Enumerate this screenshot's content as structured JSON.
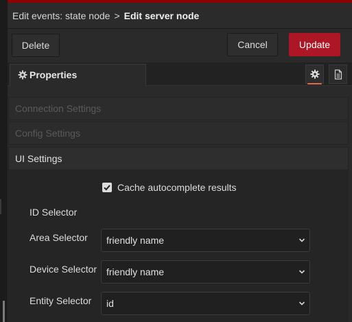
{
  "colors": {
    "accent_top": "#8f0000",
    "update_button": "#ad1625",
    "active_tab_underline": "#e36b4b"
  },
  "header": {
    "breadcrumb_parent": "Edit events: state node",
    "breadcrumb_separator": ">",
    "breadcrumb_current": "Edit server node"
  },
  "toolbar": {
    "delete_label": "Delete",
    "cancel_label": "Cancel",
    "update_label": "Update"
  },
  "tabs": {
    "properties_label": "Properties",
    "properties_icon": "gear-icon",
    "side_icons": [
      "gear-icon",
      "document-icon"
    ]
  },
  "sections": {
    "connection": "Connection Settings",
    "config": "Config Settings",
    "ui": "UI Settings"
  },
  "ui_settings": {
    "cache_checkbox_label": "Cache autocomplete results",
    "cache_checked": true,
    "id_selector_label": "ID Selector",
    "area_selector_label": "Area Selector",
    "area_selector_value": "friendly name",
    "device_selector_label": "Device Selector",
    "device_selector_value": "friendly name",
    "entity_selector_label": "Entity Selector",
    "entity_selector_value": "id"
  }
}
